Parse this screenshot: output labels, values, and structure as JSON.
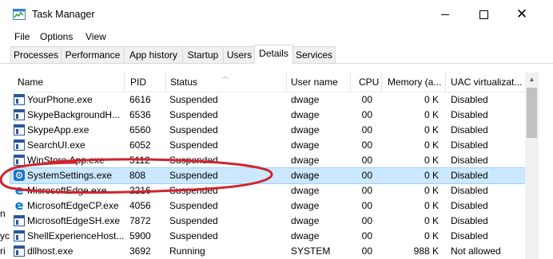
{
  "window": {
    "title": "Task Manager",
    "controls": {
      "minimize": "minimize-icon",
      "maximize": "maximize-icon",
      "close": "close-icon"
    }
  },
  "menu": [
    "File",
    "Options",
    "View"
  ],
  "tabs": [
    {
      "label": "Processes",
      "active": false
    },
    {
      "label": "Performance",
      "active": false
    },
    {
      "label": "App history",
      "active": false
    },
    {
      "label": "Startup",
      "active": false
    },
    {
      "label": "Users",
      "active": false
    },
    {
      "label": "Details",
      "active": true
    },
    {
      "label": "Services",
      "active": false
    }
  ],
  "columns": [
    "Name",
    "PID",
    "Status",
    "User name",
    "CPU",
    "Memory (a...",
    "UAC virtualizat..."
  ],
  "sort": {
    "column": "Status",
    "icon": "sort-up-icon"
  },
  "rows": [
    {
      "icon": "window-icon",
      "name": "YourPhone.exe",
      "pid": "6616",
      "status": "Suspended",
      "user": "dwage",
      "cpu": "00",
      "memory": "0 K",
      "uac": "Disabled",
      "selected": false
    },
    {
      "icon": "window-icon",
      "name": "SkypeBackgroundH...",
      "pid": "6536",
      "status": "Suspended",
      "user": "dwage",
      "cpu": "00",
      "memory": "0 K",
      "uac": "Disabled",
      "selected": false
    },
    {
      "icon": "window-icon",
      "name": "SkypeApp.exe",
      "pid": "6560",
      "status": "Suspended",
      "user": "dwage",
      "cpu": "00",
      "memory": "0 K",
      "uac": "Disabled",
      "selected": false
    },
    {
      "icon": "window-icon",
      "name": "SearchUI.exe",
      "pid": "6052",
      "status": "Suspended",
      "user": "dwage",
      "cpu": "00",
      "memory": "0 K",
      "uac": "Disabled",
      "selected": false
    },
    {
      "icon": "window-icon",
      "name": "WinStore.App.exe",
      "pid": "5112",
      "status": "Suspended",
      "user": "dwage",
      "cpu": "00",
      "memory": "0 K",
      "uac": "Disabled",
      "selected": false
    },
    {
      "icon": "gear-icon",
      "name": "SystemSettings.exe",
      "pid": "808",
      "status": "Suspended",
      "user": "dwage",
      "cpu": "00",
      "memory": "0 K",
      "uac": "Disabled",
      "selected": true
    },
    {
      "icon": "edge-icon",
      "name": "MicrosoftEdge.exe",
      "pid": "2216",
      "status": "Suspended",
      "user": "dwage",
      "cpu": "00",
      "memory": "0 K",
      "uac": "Disabled",
      "selected": false
    },
    {
      "icon": "edge-icon",
      "name": "MicrosoftEdgeCP.exe",
      "pid": "4056",
      "status": "Suspended",
      "user": "dwage",
      "cpu": "00",
      "memory": "0 K",
      "uac": "Disabled",
      "selected": false
    },
    {
      "icon": "window-icon",
      "name": "MicrosoftEdgeSH.exe",
      "pid": "7872",
      "status": "Suspended",
      "user": "dwage",
      "cpu": "00",
      "memory": "0 K",
      "uac": "Disabled",
      "selected": false
    },
    {
      "icon": "window-icon",
      "name": "ShellExperienceHost...",
      "pid": "5900",
      "status": "Suspended",
      "user": "dwage",
      "cpu": "00",
      "memory": "0 K",
      "uac": "Disabled",
      "selected": false
    },
    {
      "icon": "window-icon",
      "name": "dllhost.exe",
      "pid": "3692",
      "status": "Running",
      "user": "SYSTEM",
      "cpu": "00",
      "memory": "988 K",
      "uac": "Not allowed",
      "selected": false
    }
  ],
  "background_window": {
    "fragments": [
      "n",
      "yc",
      "ri"
    ]
  },
  "annotation": {
    "color": "#d0242b"
  },
  "colors": {
    "selection": "#cce8ff",
    "selection_border": "#99d1ff",
    "tab_border": "#d9d9d9"
  }
}
